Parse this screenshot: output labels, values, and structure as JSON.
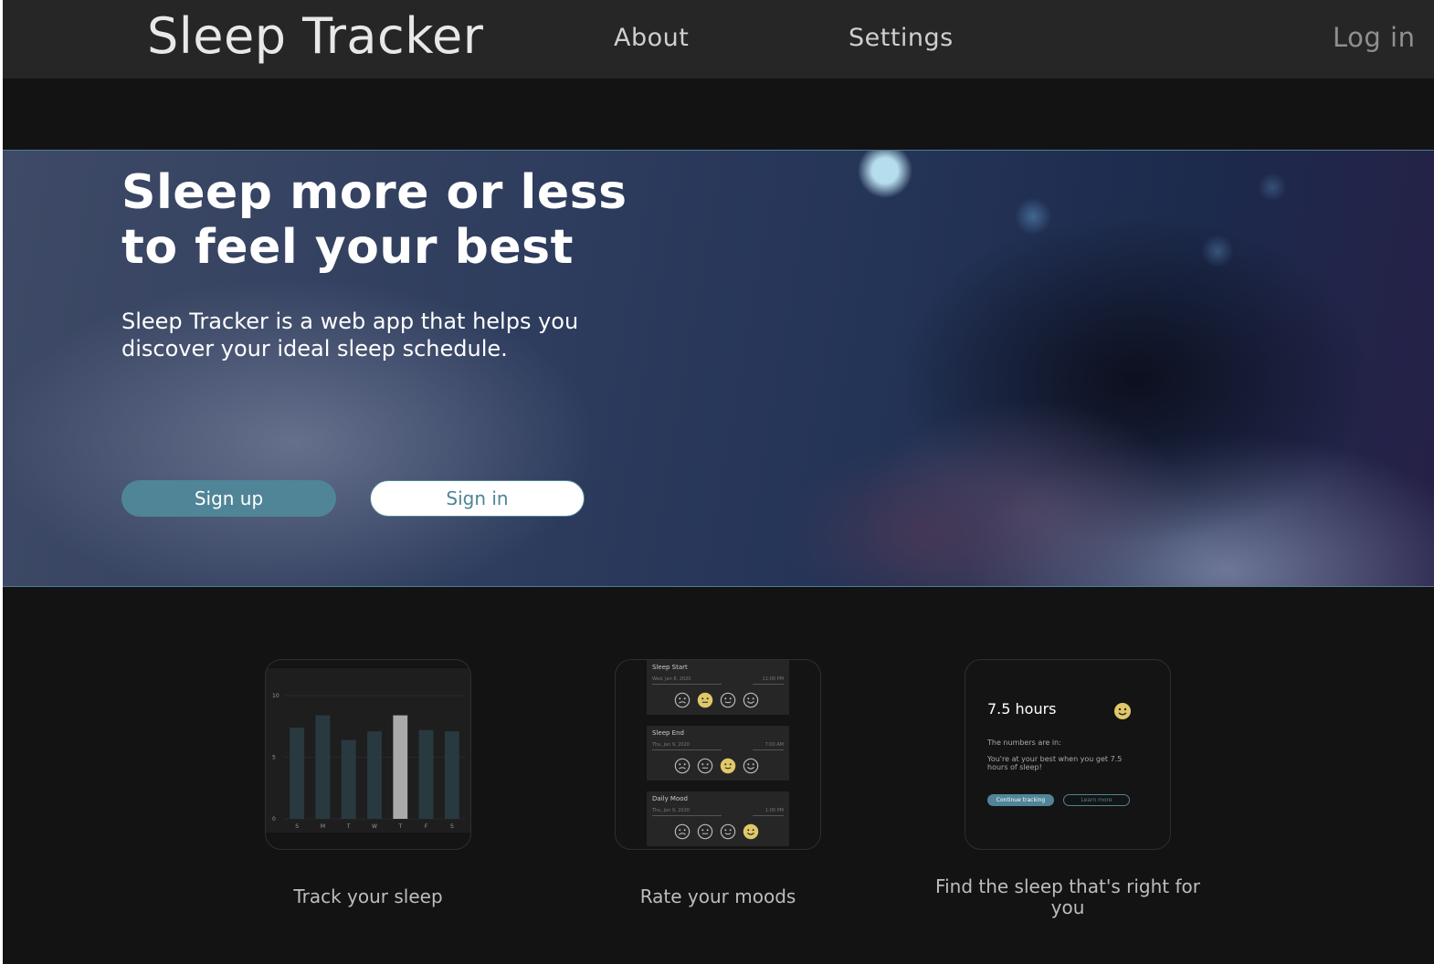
{
  "header": {
    "brand": "Sleep Tracker",
    "nav": {
      "about": "About",
      "settings": "Settings",
      "login": "Log in"
    }
  },
  "hero": {
    "title": "Sleep more or less\nto feel your best",
    "subtitle": "Sleep Tracker is a web app that helps you discover your ideal sleep schedule.",
    "signup_label": "Sign up",
    "signin_label": "Sign in"
  },
  "features": [
    {
      "caption": "Track your sleep",
      "chart_data": {
        "type": "bar",
        "categories": [
          "S",
          "M",
          "T",
          "W",
          "T",
          "F",
          "S"
        ],
        "values": [
          7.4,
          8.4,
          6.4,
          7.1,
          8.4,
          7.2,
          7.1
        ],
        "highlight_index": 4,
        "yticks": [
          0,
          5,
          10
        ],
        "ylim": [
          0,
          10
        ],
        "colors": {
          "bar": "#283a3f",
          "highlight": "#aaaaaa"
        }
      }
    },
    {
      "caption": "Rate your moods",
      "entries": [
        {
          "label": "Sleep Start",
          "date": "Wed, Jan 8, 2020",
          "time": "11:00 PM",
          "selected": 1
        },
        {
          "label": "Sleep End",
          "date": "Thu, Jan 9, 2020",
          "time": "7:00 AM",
          "selected": 2
        },
        {
          "label": "Daily Mood",
          "date": "Thu, Jan 9, 2020",
          "time": "1:00 PM",
          "selected": 3
        }
      ],
      "faces": [
        "sad-face-icon",
        "neutral-face-icon",
        "slight-smile-face-icon",
        "smile-face-icon"
      ]
    },
    {
      "caption": "Find the sleep that's right for you",
      "hours": "7.5 hours",
      "line1": "The numbers are in:",
      "line2": "You're at your best when you get 7.5 hours of sleep!",
      "primary_btn": "Continue tracking",
      "secondary_btn": "Learn more"
    }
  ],
  "colors": {
    "accent": "#4f8597",
    "emoji_yellow": "#e0c868"
  }
}
